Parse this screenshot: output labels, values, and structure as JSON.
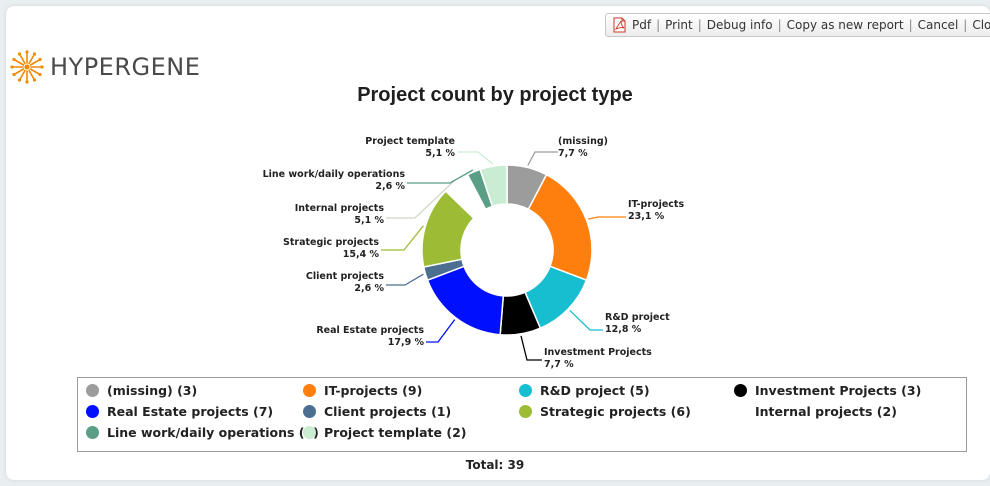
{
  "toolbar": {
    "pdf": "Pdf",
    "print": "Print",
    "debug": "Debug info",
    "copy": "Copy as new report",
    "cancel": "Cancel",
    "close": "Close",
    "separator": "|"
  },
  "brand": {
    "name": "HYPERGENE",
    "accent": "#f08a00"
  },
  "chart_data": {
    "type": "pie",
    "donut": true,
    "title": "Project count by project type",
    "series": [
      {
        "name": "(missing)",
        "value": 3,
        "percent_label": "7,7 %",
        "legend_label": "(missing) (3)",
        "color": "#9c9c9c"
      },
      {
        "name": "IT-projects",
        "value": 9,
        "percent_label": "23,1 %",
        "legend_label": "IT-projects (9)",
        "color": "#ff7f0e"
      },
      {
        "name": "R&D project",
        "value": 5,
        "percent_label": "12,8 %",
        "legend_label": "R&D project (5)",
        "color": "#17becf"
      },
      {
        "name": "Investment Projects",
        "value": 3,
        "percent_label": "7,7 %",
        "legend_label": "Investment Projects (3)",
        "color": "#000000"
      },
      {
        "name": "Real Estate projects",
        "value": 7,
        "percent_label": "17,9 %",
        "legend_label": "Real Estate projects (7)",
        "color": "#0010ff"
      },
      {
        "name": "Client projects",
        "value": 1,
        "percent_label": "2,6 %",
        "legend_label": "Client projects (1)",
        "color": "#4c6f91"
      },
      {
        "name": "Strategic projects",
        "value": 6,
        "percent_label": "15,4 %",
        "legend_label": "Strategic projects (6)",
        "color": "#9cbc35"
      },
      {
        "name": "Internal projects",
        "value": 2,
        "percent_label": "5,1 %",
        "legend_label": "Internal projects (2)",
        "color": "#ffffff"
      },
      {
        "name": "Line work/daily operations",
        "value": 1,
        "percent_label": "2,6 %",
        "legend_label": "Line work/daily operations (1)",
        "color": "#5b9e86"
      },
      {
        "name": "Project template",
        "value": 2,
        "percent_label": "5,1 %",
        "legend_label": "Project template (2)",
        "color": "#c9ecd3"
      }
    ],
    "total_label": "Total: 39",
    "legend_position": "bottom"
  }
}
